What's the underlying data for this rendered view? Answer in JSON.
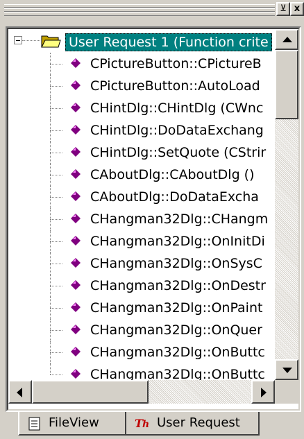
{
  "titlebar": {
    "restore_glyph": "⊻",
    "close_glyph": "x"
  },
  "tree": {
    "root": {
      "label": "User Request 1 (Function crite",
      "icon": "open-folder-icon"
    },
    "items": [
      {
        "label": "CPictureButton::CPictureB"
      },
      {
        "label": "CPictureButton::AutoLoad"
      },
      {
        "label": "CHintDlg::CHintDlg (CWnc"
      },
      {
        "label": "CHintDlg::DoDataExchang"
      },
      {
        "label": "CHintDlg::SetQuote (CStrir"
      },
      {
        "label": "CAboutDlg::CAboutDlg ()"
      },
      {
        "label": "CAboutDlg::DoDataExcha"
      },
      {
        "label": "CHangman32Dlg::CHangm"
      },
      {
        "label": "CHangman32Dlg::OnInitDi"
      },
      {
        "label": "CHangman32Dlg::OnSysC"
      },
      {
        "label": "CHangman32Dlg::OnDestr"
      },
      {
        "label": "CHangman32Dlg::OnPaint"
      },
      {
        "label": "CHangman32Dlg::OnQuer"
      },
      {
        "label": "CHangman32Dlg::OnButtc"
      },
      {
        "label": "CHangman32Dlg::OnButtc"
      }
    ]
  },
  "tabs": [
    {
      "label": "FileView",
      "icon": "document-icon",
      "active": false
    },
    {
      "label": "User Request",
      "icon": "user-request-icon",
      "active": true
    }
  ],
  "colors": {
    "selection": "#008080",
    "item_diamond": "#800080",
    "face": "#d4d0c8"
  }
}
